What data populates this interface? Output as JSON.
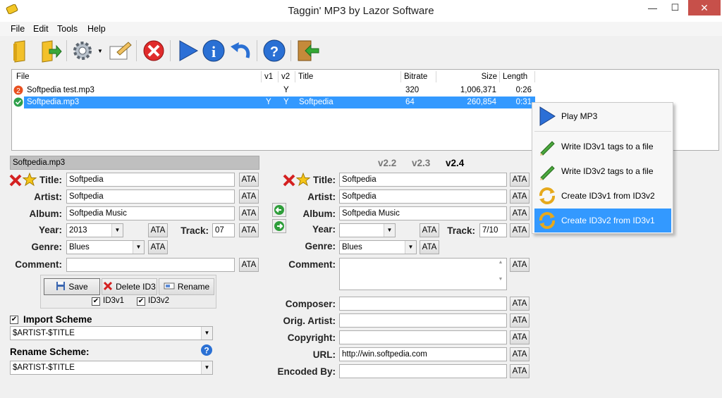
{
  "window": {
    "title": "Taggin' MP3   by Lazor Software",
    "min": "—",
    "max": "☐",
    "close": "✕"
  },
  "menu": [
    "File",
    "Edit",
    "Tools",
    "Help"
  ],
  "list": {
    "columns": [
      "File",
      "v1",
      "v2",
      "Title",
      "Bitrate",
      "Size",
      "Length"
    ],
    "rows": [
      {
        "file": "Softpedia test.mp3",
        "v1": "",
        "v2": "Y",
        "title": "",
        "bitrate": "320",
        "size": "1,006,371",
        "length": "0:26"
      },
      {
        "file": "Softpedia.mp3",
        "v1": "Y",
        "v2": "Y",
        "title": "Softpedia",
        "bitrate": "64",
        "size": "260,854",
        "length": "0:31"
      }
    ]
  },
  "left": {
    "filename": "Softpedia.mp3",
    "title_label": "Title:",
    "title": "Softpedia",
    "artist_label": "Artist:",
    "artist": "Softpedia",
    "album_label": "Album:",
    "album": "Softpedia Music",
    "year_label": "Year:",
    "year": "2013",
    "track_label": "Track:",
    "track": "07",
    "genre_label": "Genre:",
    "genre": "Blues",
    "comment_label": "Comment:",
    "comment": "",
    "ata": "ATA",
    "save": "Save",
    "delete": "Delete ID3",
    "rename": "Rename",
    "id3v1": "ID3v1",
    "id3v2": "ID3v2",
    "import_label": "Import Scheme",
    "import_value": "$ARTIST-$TITLE",
    "rename_label": "Rename Scheme:",
    "rename_value": "$ARTIST-$TITLE"
  },
  "right": {
    "versions": [
      "v2.2",
      "v2.3",
      "v2.4"
    ],
    "active_version": "v2.4",
    "title_label": "Title:",
    "title": "Softpedia",
    "artist_label": "Artist:",
    "artist": "Softpedia",
    "album_label": "Album:",
    "album": "Softpedia Music",
    "year_label": "Year:",
    "year": "",
    "track_label": "Track:",
    "track": "7/10",
    "genre_label": "Genre:",
    "genre": "Blues",
    "comment_label": "Comment:",
    "comment": "",
    "composer_label": "Composer:",
    "origartist_label": "Orig. Artist:",
    "copyright_label": "Copyright:",
    "url_label": "URL:",
    "url": "http://win.softpedia.com",
    "encodedby_label": "Encoded By:"
  },
  "context_menu": {
    "items": [
      "Play MP3",
      "Write ID3v1 tags to a file",
      "Write ID3v2 tags to a file",
      "Create ID3v1 from ID3v2",
      "Create ID3v2 from ID3v1"
    ],
    "highlighted": "Create ID3v2 from ID3v1"
  },
  "colors": {
    "accent": "#3399ff",
    "close": "#c7504a"
  }
}
